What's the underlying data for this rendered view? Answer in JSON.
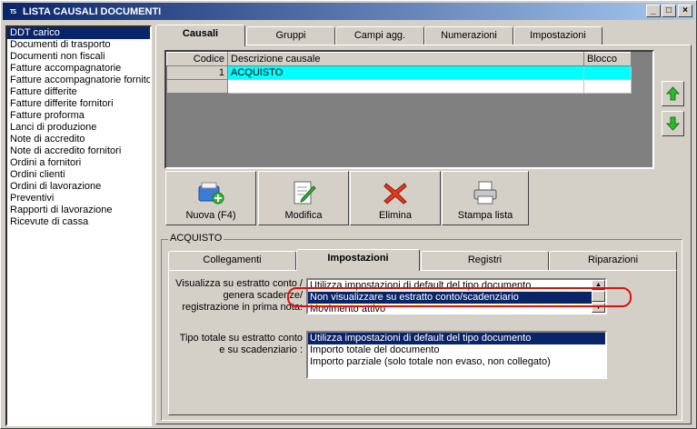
{
  "window": {
    "title": "LISTA CAUSALI DOCUMENTI",
    "app_icon": "TS",
    "minimize": "_",
    "maximize": "□",
    "close": "×"
  },
  "sidebar": {
    "items": [
      "DDT carico",
      "Documenti di trasporto",
      "Documenti non fiscali",
      "Fatture accompagnatorie",
      "Fatture accompagnatorie fornitori",
      "Fatture differite",
      "Fatture differite fornitori",
      "Fatture proforma",
      "Lanci di produzione",
      "Note di accredito",
      "Note di accredito fornitori",
      "Ordini a fornitori",
      "Ordini clienti",
      "Ordini di lavorazione",
      "Preventivi",
      "Rapporti di lavorazione",
      "Ricevute di cassa"
    ],
    "selected_index": 0
  },
  "main_tabs": [
    "Causali",
    "Gruppi",
    "Campi agg.",
    "Numerazioni",
    "Impostazioni"
  ],
  "grid": {
    "headers": [
      "Codice",
      "Descrizione causale",
      "Blocco"
    ],
    "rows": [
      {
        "codice": "1",
        "descrizione": "ACQUISTO",
        "blocco": ""
      }
    ]
  },
  "toolbar": {
    "new_label": "Nuova (F4)",
    "edit_label": "Modifica",
    "delete_label": "Elimina",
    "print_label": "Stampa lista"
  },
  "detail": {
    "group_title": "ACQUISTO",
    "tabs": [
      "Collegamenti",
      "Impostazioni",
      "Registri",
      "Riparazioni"
    ],
    "field1_label_lines": [
      "Visualizza su estratto conto /",
      "genera scadenze/",
      "registrazione  in prima nota:"
    ],
    "field1_options": [
      "Utilizza impostazioni di default del tipo documento",
      "Non visualizzare su estratto conto/scadenziario",
      "Movimento attivo"
    ],
    "field2_label_lines": [
      "Tipo totale su estratto conto",
      "e su scadenziario :"
    ],
    "field2_options": [
      "Utilizza impostazioni di default del tipo documento",
      "Importo totale del documento",
      "Importo parziale (solo totale non evaso, non collegato)"
    ]
  },
  "colors": {
    "selection": "#0a246a",
    "grid_row_highlight": "#00ffff",
    "annotation": "#e01010"
  }
}
